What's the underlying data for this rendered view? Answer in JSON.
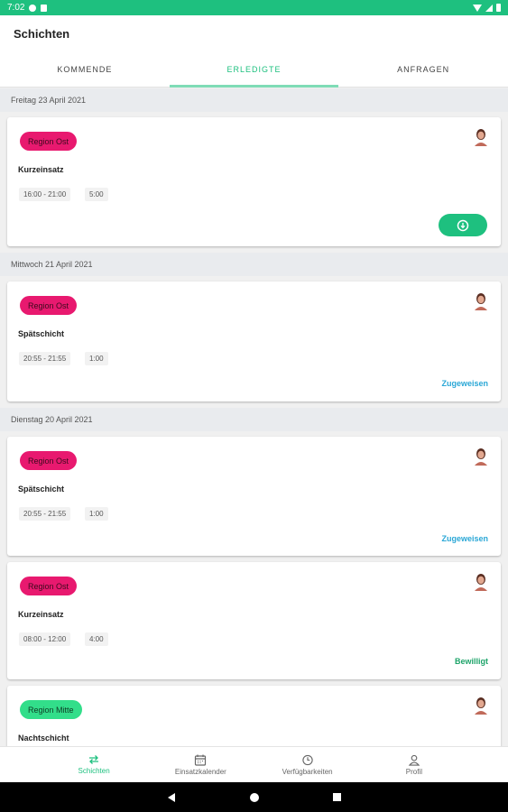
{
  "status_bar": {
    "time": "7:02"
  },
  "app": {
    "title": "Schichten"
  },
  "tabs": [
    {
      "label": "KOMMENDE"
    },
    {
      "label": "ERLEDIGTE"
    },
    {
      "label": "ANFRAGEN"
    }
  ],
  "groups": [
    {
      "date": "Freitag 23 April 2021",
      "cards": [
        {
          "region": "Region Ost",
          "shift": "Kurzeinsatz",
          "time": "16:00 - 21:00",
          "duration": "5:00",
          "action": ""
        }
      ]
    },
    {
      "date": "Mittwoch 21 April 2021",
      "cards": [
        {
          "region": "Region Ost",
          "shift": "Spätschicht",
          "time": "20:55 - 21:55",
          "duration": "1:00",
          "action": "Zugeweisen"
        }
      ]
    },
    {
      "date": "Dienstag 20 April 2021",
      "cards": [
        {
          "region": "Region Ost",
          "shift": "Spätschicht",
          "time": "20:55 - 21:55",
          "duration": "1:00",
          "action": "Zugeweisen"
        },
        {
          "region": "Region Ost",
          "shift": "Kurzeinsatz",
          "time": "08:00 - 12:00",
          "duration": "4:00",
          "action": "Bewilligt"
        },
        {
          "region": "Region Mitte",
          "shift": "Nachtschicht",
          "time": "",
          "duration": "",
          "action": ""
        }
      ]
    }
  ],
  "bottom_nav": [
    {
      "label": "Schichten",
      "icon": "swap-arrows-icon"
    },
    {
      "label": "Einsatzkalender",
      "icon": "calendar-icon"
    },
    {
      "label": "Verfügbarkeiten",
      "icon": "clock-icon"
    },
    {
      "label": "Profil",
      "icon": "person-icon"
    }
  ],
  "colors": {
    "accent": "#1ec07f",
    "region_ost": "#e8196f",
    "region_mitte": "#32de8a",
    "link_blue": "#2aa7d6"
  }
}
